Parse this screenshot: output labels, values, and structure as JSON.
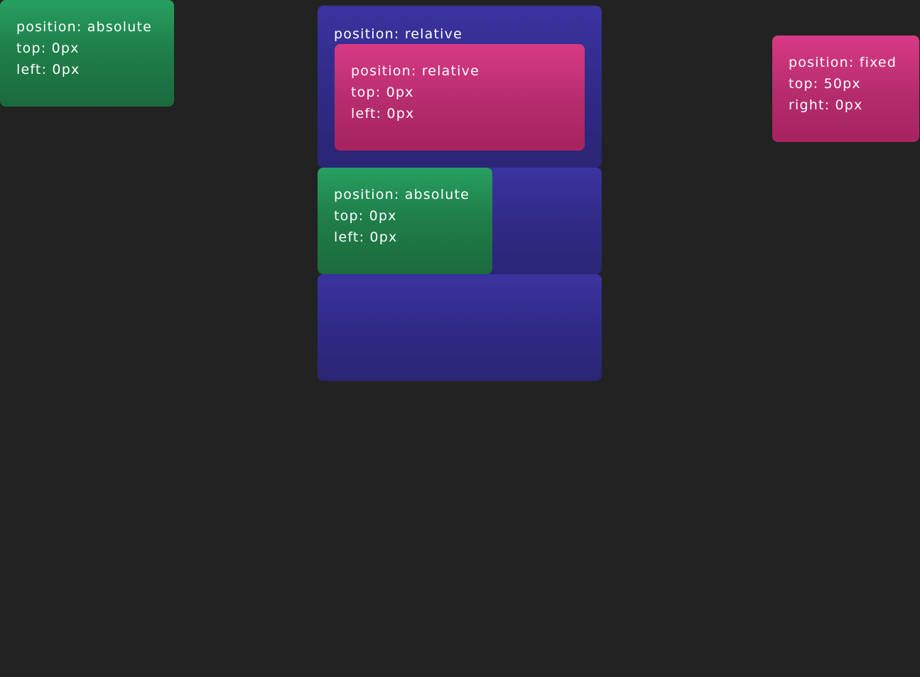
{
  "colors": {
    "background": "#222222",
    "green": "#27a061",
    "pink": "#d83a85",
    "blue": "#3b33a0",
    "text": "#ffffff"
  },
  "absolute_box": {
    "line1": "position: absolute",
    "line2": "top: 0px",
    "line3": "left: 0px"
  },
  "relative_container": {
    "label": "position: relative"
  },
  "relative_inner_box": {
    "line1": "position: relative",
    "line2": "top: 0px",
    "line3": "left: 0px"
  },
  "nested_absolute_box": {
    "line1": "position: absolute",
    "line2": "top: 0px",
    "line3": "left: 0px"
  },
  "fixed_box": {
    "line1": "position: fixed",
    "line2": "top: 50px",
    "line3": "right: 0px"
  }
}
